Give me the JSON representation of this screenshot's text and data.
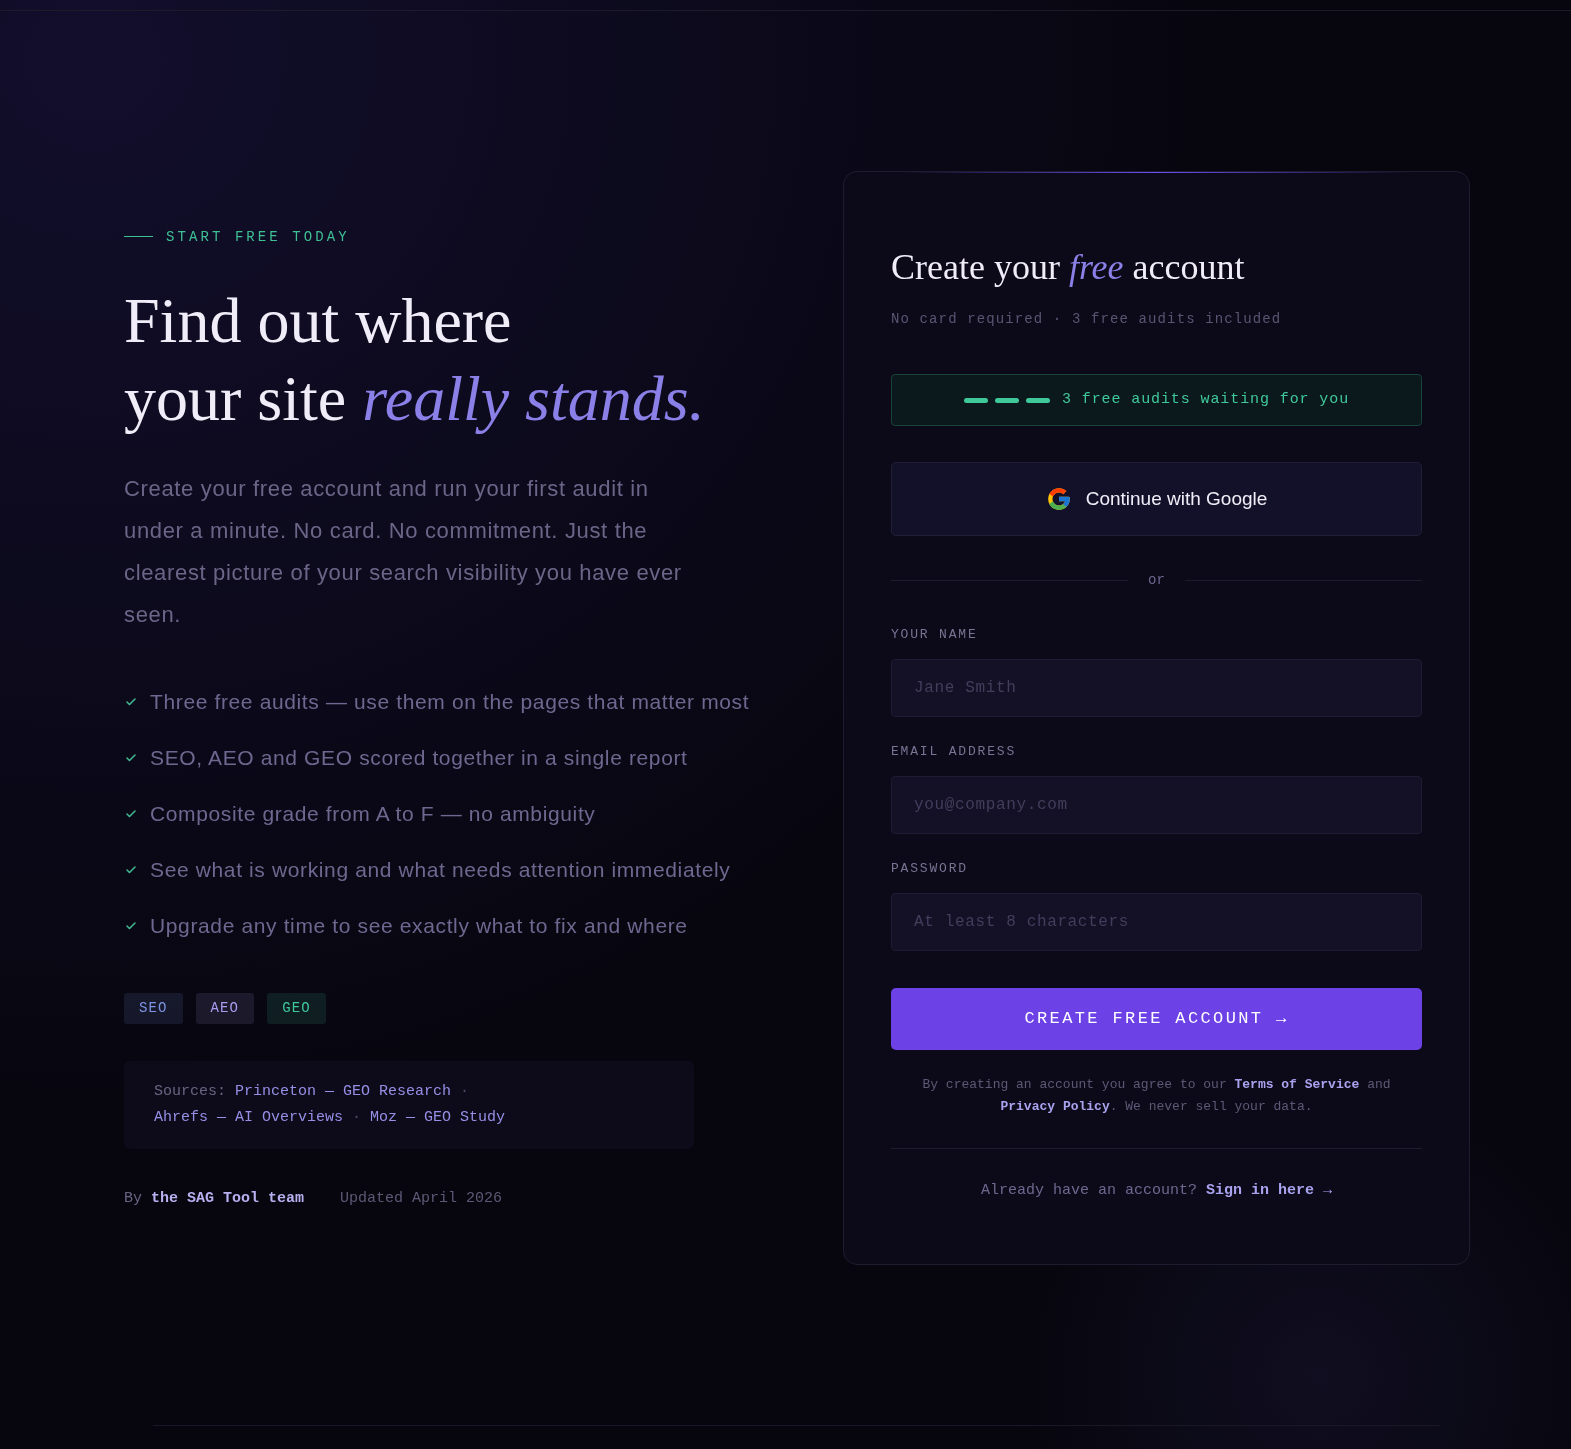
{
  "eyebrow": "START FREE TODAY",
  "headline": {
    "lines": [
      "Find out where",
      "your site *really stands.*"
    ]
  },
  "intro": "Create your free account and run your first audit in under a minute. No card. No commitment. Just the clearest picture of your search visibility you have ever seen.",
  "benefits": [
    "Three free audits — use them on the pages that matter most",
    "SEO, AEO and GEO scored together in a single report",
    "Composite grade from A to F — no ambiguity",
    "See what is working and what needs attention immediately",
    "Upgrade any time to see exactly what to fix and where"
  ],
  "tags": [
    {
      "label": "SEO",
      "color": "#7d93e3"
    },
    {
      "label": "AEO",
      "color": "#a99cf0"
    },
    {
      "label": "GEO",
      "color": "#3fc99a"
    }
  ],
  "sources": {
    "label": "Sources:",
    "items": [
      {
        "kind": "link",
        "text": "Princeton — GEO Research"
      },
      {
        "kind": "separator",
        "text": "·"
      },
      {
        "kind": "link",
        "text": "Ahrefs — AI Overviews"
      },
      {
        "kind": "separator",
        "text": "·"
      },
      {
        "kind": "link",
        "text": "Moz — GEO Study"
      }
    ]
  },
  "byline": {
    "prefix": "By ",
    "author": "the SAG Tool team",
    "updated": "Updated April 2026"
  },
  "signup_card": {
    "title": "Create your *free* account",
    "subtitle": "No card required · 3 free audits included",
    "audit_badge": {
      "slots": [
        {
          "available": true
        },
        {
          "available": true
        },
        {
          "available": true
        }
      ],
      "text": "3 free audits waiting for you"
    },
    "google_button": "Continue with Google",
    "divider": "or",
    "fields": [
      {
        "label": "YOUR NAME",
        "placeholder": "Jane Smith"
      },
      {
        "label": "EMAIL ADDRESS",
        "placeholder": "you@company.com"
      },
      {
        "label": "PASSWORD",
        "placeholder": "At least 8 characters"
      }
    ],
    "submit_button": "CREATE FREE ACCOUNT →",
    "terms": [
      {
        "kind": "text",
        "text": "By creating an account you agree to our "
      },
      {
        "kind": "link",
        "text": "Terms of Service"
      },
      {
        "kind": "text",
        "text": " and "
      },
      {
        "kind": "link",
        "text": "Privacy Policy"
      },
      {
        "kind": "text",
        "text": ". We never sell your data."
      }
    ],
    "signin": {
      "prompt": "Already have an account? ",
      "link": "Sign in here →"
    }
  }
}
